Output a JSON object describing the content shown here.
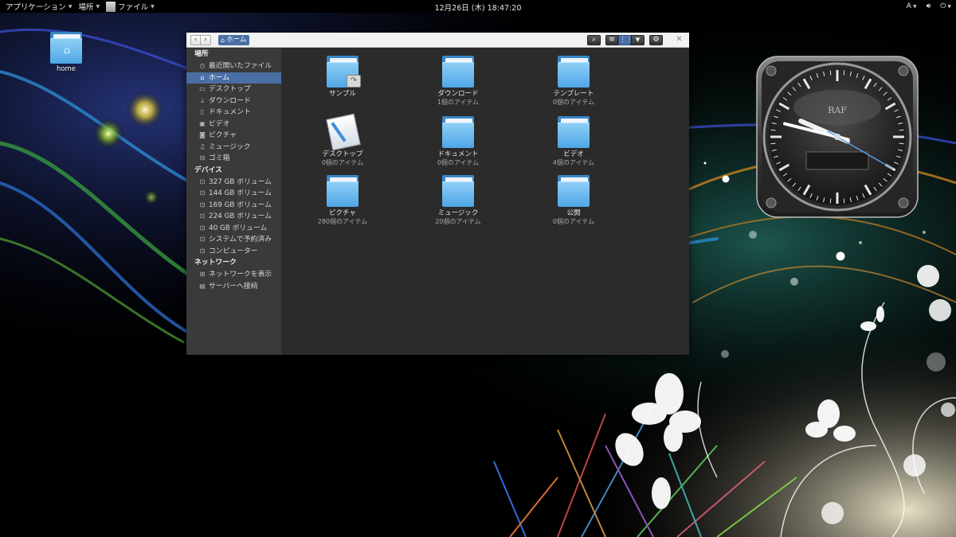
{
  "topbar": {
    "apps_label": "アプリケーション",
    "places_label": "場所",
    "files_label": "ファイル",
    "clock": "12月26日 (木) 18:47:20",
    "input_method": "A"
  },
  "desktop": {
    "home_label": "home"
  },
  "window": {
    "path_label": "ホーム",
    "sidebar": {
      "places_header": "場所",
      "places": [
        {
          "label": "最近開いたファイル",
          "icon": "clock-icon"
        },
        {
          "label": "ホーム",
          "icon": "home-icon",
          "selected": true
        },
        {
          "label": "デスクトップ",
          "icon": "desktop-icon"
        },
        {
          "label": "ダウンロード",
          "icon": "download-icon"
        },
        {
          "label": "ドキュメント",
          "icon": "document-icon"
        },
        {
          "label": "ビデオ",
          "icon": "video-icon"
        },
        {
          "label": "ピクチャ",
          "icon": "camera-icon"
        },
        {
          "label": "ミュージック",
          "icon": "music-icon"
        },
        {
          "label": "ゴミ箱",
          "icon": "trash-icon"
        }
      ],
      "devices_header": "デバイス",
      "devices": [
        {
          "label": "327 GB ボリューム"
        },
        {
          "label": "144 GB ボリューム"
        },
        {
          "label": "169 GB ボリューム"
        },
        {
          "label": "224 GB ボリューム"
        },
        {
          "label": "40 GB ボリューム"
        },
        {
          "label": "システムで予約済み"
        },
        {
          "label": "コンピューター"
        }
      ],
      "network_header": "ネットワーク",
      "network": [
        {
          "label": "ネットワークを表示"
        },
        {
          "label": "サーバーへ接続"
        }
      ]
    },
    "items": [
      {
        "name": "サンプル",
        "count": ""
      },
      {
        "name": "ダウンロード",
        "count": "1個のアイテム"
      },
      {
        "name": "テンプレート",
        "count": "0個のアイテム"
      },
      {
        "name": "デスクトップ",
        "count": "0個のアイテム"
      },
      {
        "name": "ドキュメント",
        "count": "0個のアイテム"
      },
      {
        "name": "ビデオ",
        "count": "4個のアイテム"
      },
      {
        "name": "ピクチャ",
        "count": "280個のアイテム"
      },
      {
        "name": "ミュージック",
        "count": "20個のアイテム"
      },
      {
        "name": "公開",
        "count": "0個のアイテム"
      }
    ]
  },
  "clock_widget": {
    "brand": "RAF",
    "hours": 9,
    "minutes": 47,
    "seconds": 20
  },
  "colors": {
    "accent": "#4a6fa5",
    "folder": "#5fb3ee",
    "sidebar_bg": "#3a3a3a",
    "content_bg": "#2b2b2b"
  }
}
